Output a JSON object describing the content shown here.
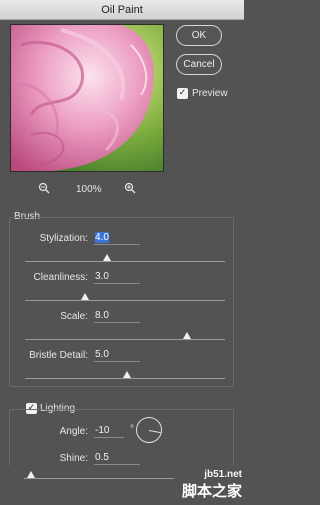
{
  "window": {
    "title": "Oil Paint"
  },
  "buttons": {
    "ok": "OK",
    "cancel": "Cancel"
  },
  "preview_toggle": {
    "label": "Preview",
    "checked": true
  },
  "zoom": {
    "level": "100%"
  },
  "brush": {
    "heading": "Brush",
    "sliders": [
      {
        "label": "Stylization:",
        "value": "4.0",
        "fraction": 0.41
      },
      {
        "label": "Cleanliness:",
        "value": "3.0",
        "fraction": 0.3
      },
      {
        "label": "Scale:",
        "value": "8.0",
        "fraction": 0.81
      },
      {
        "label": "Bristle Detail:",
        "value": "5.0",
        "fraction": 0.51
      }
    ]
  },
  "lighting": {
    "heading": "Lighting",
    "checked": true,
    "angle": {
      "label": "Angle:",
      "value": "-10",
      "unit": "°"
    },
    "shine": {
      "label": "Shine:",
      "value": "0.5",
      "fraction": 0.05
    }
  },
  "watermark": {
    "line1": "jb51.net",
    "line2": "脚本之家"
  },
  "colors": {
    "highlight": "#3874d6",
    "panel_bg": "#535353"
  }
}
